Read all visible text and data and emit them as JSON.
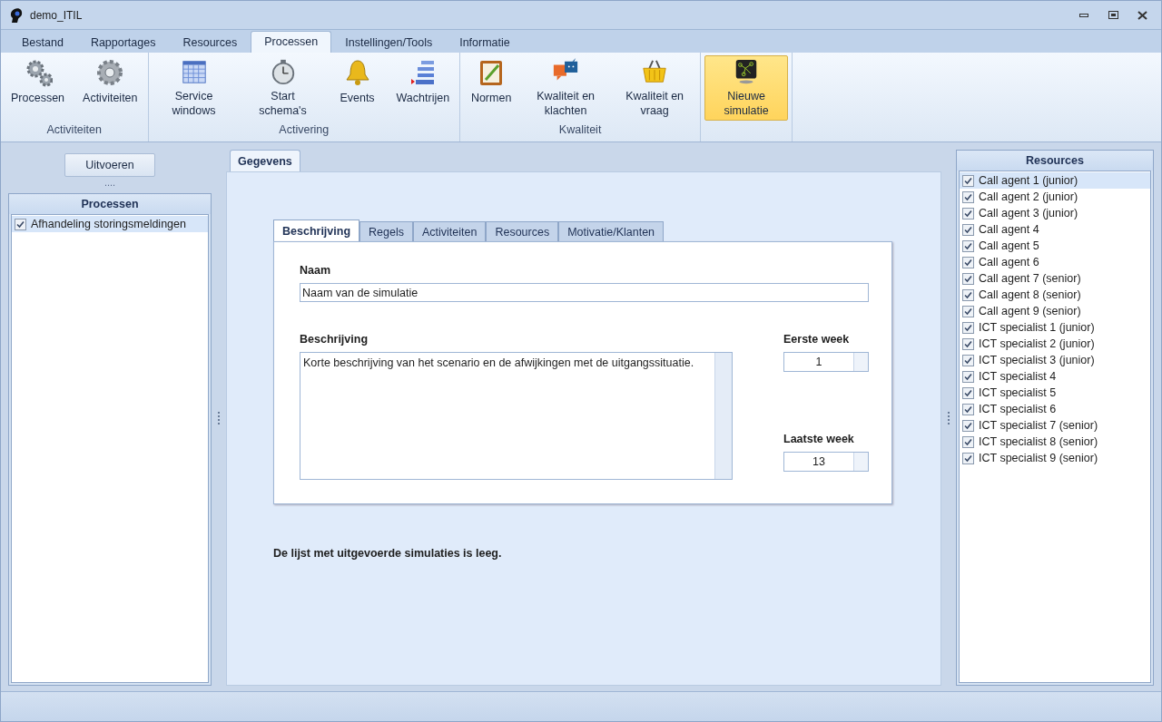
{
  "window": {
    "title": "demo_ITIL"
  },
  "menu_tabs": [
    {
      "label": "Bestand",
      "selected": false
    },
    {
      "label": "Rapportages",
      "selected": false
    },
    {
      "label": "Resources",
      "selected": false
    },
    {
      "label": "Processen",
      "selected": true
    },
    {
      "label": "Instellingen/Tools",
      "selected": false
    },
    {
      "label": "Informatie",
      "selected": false
    }
  ],
  "ribbon_groups": [
    {
      "label": "Activiteiten",
      "buttons": [
        {
          "label": "Processen",
          "selected": false
        },
        {
          "label": "Activiteiten",
          "selected": false
        }
      ]
    },
    {
      "label": "Activering",
      "buttons": [
        {
          "label": "Service windows",
          "selected": false
        },
        {
          "label": "Start schema's",
          "selected": false
        },
        {
          "label": "Events",
          "selected": false
        },
        {
          "label": "Wachtrijen",
          "selected": false
        }
      ]
    },
    {
      "label": "Kwaliteit",
      "buttons": [
        {
          "label": "Normen",
          "selected": false
        },
        {
          "label": "Kwaliteit en klachten",
          "selected": false
        },
        {
          "label": "Kwaliteit en vraag",
          "selected": false
        }
      ]
    },
    {
      "buttons": [
        {
          "label": "Nieuwe simulatie",
          "selected": true
        }
      ]
    }
  ],
  "left_panel": {
    "run_button": "Uitvoeren",
    "dots": "....",
    "title": "Processen",
    "items": [
      {
        "label": "Afhandeling storingsmeldingen",
        "checked": true,
        "selected": true
      }
    ]
  },
  "document_tabs": [
    {
      "label": "Gegevens",
      "selected": true
    }
  ],
  "form_tabs": [
    {
      "label": "Beschrijving",
      "selected": true
    },
    {
      "label": "Regels",
      "selected": false
    },
    {
      "label": "Activiteiten",
      "selected": false
    },
    {
      "label": "Resources",
      "selected": false
    },
    {
      "label": "Motivatie/Klanten",
      "selected": false
    }
  ],
  "form": {
    "name_label": "Naam",
    "name_value": "Naam van de simulatie",
    "description_label": "Beschrijving",
    "description_value": "Korte beschrijving van het scenario en de afwijkingen met de uitgangssituatie.",
    "first_week_label": "Eerste week",
    "first_week_value": "1",
    "last_week_label": "Laatste week",
    "last_week_value": "13"
  },
  "message": "De lijst met uitgevoerde simulaties is leeg.",
  "right_panel": {
    "title": "Resources",
    "items": [
      {
        "label": "Call agent 1 (junior)",
        "checked": true,
        "selected": true
      },
      {
        "label": "Call agent 2 (junior)",
        "checked": true,
        "selected": false
      },
      {
        "label": "Call agent 3 (junior)",
        "checked": true,
        "selected": false
      },
      {
        "label": "Call agent 4",
        "checked": true,
        "selected": false
      },
      {
        "label": "Call agent 5",
        "checked": true,
        "selected": false
      },
      {
        "label": "Call agent 6",
        "checked": true,
        "selected": false
      },
      {
        "label": "Call agent 7 (senior)",
        "checked": true,
        "selected": false
      },
      {
        "label": "Call agent 8 (senior)",
        "checked": true,
        "selected": false
      },
      {
        "label": "Call agent 9 (senior)",
        "checked": true,
        "selected": false
      },
      {
        "label": "ICT specialist 1 (junior)",
        "checked": true,
        "selected": false
      },
      {
        "label": "ICT specialist 2 (junior)",
        "checked": true,
        "selected": false
      },
      {
        "label": "ICT specialist 3 (junior)",
        "checked": true,
        "selected": false
      },
      {
        "label": "ICT specialist 4",
        "checked": true,
        "selected": false
      },
      {
        "label": "ICT specialist 5",
        "checked": true,
        "selected": false
      },
      {
        "label": "ICT specialist 6",
        "checked": true,
        "selected": false
      },
      {
        "label": "ICT specialist 7 (senior)",
        "checked": true,
        "selected": false
      },
      {
        "label": "ICT specialist 8 (senior)",
        "checked": true,
        "selected": false
      },
      {
        "label": "ICT specialist 9 (senior)",
        "checked": true,
        "selected": false
      }
    ]
  }
}
